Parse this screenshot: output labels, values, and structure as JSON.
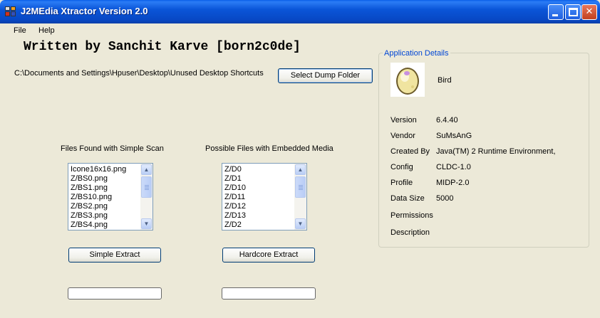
{
  "window": {
    "title": "J2MEdia Xtractor Version 2.0",
    "controls": {
      "minimize": "minimize",
      "maximize": "maximize",
      "close": "close"
    }
  },
  "menu": {
    "file": "File",
    "help": "Help"
  },
  "main": {
    "author": "Written by Sanchit Karve [born2c0de]",
    "path": "C:\\Documents and Settings\\Hpuser\\Desktop\\Unused Desktop Shortcuts",
    "select_dump_label": "Select Dump Folder"
  },
  "simple_scan": {
    "caption": "Files Found with Simple Scan",
    "items": [
      "Icone16x16.png",
      "Z/BS0.png",
      "Z/BS1.png",
      "Z/BS10.png",
      "Z/BS2.png",
      "Z/BS3.png",
      "Z/BS4.png"
    ],
    "extract_label": "Simple Extract",
    "progress": 0
  },
  "embedded": {
    "caption": "Possible Files with Embedded Media",
    "items": [
      "Z/D0",
      "Z/D1",
      "Z/D10",
      "Z/D11",
      "Z/D12",
      "Z/D13",
      "Z/D2"
    ],
    "extract_label": "Hardcore Extract",
    "progress": 0
  },
  "details": {
    "title": "Application Details",
    "app_name": "Bird",
    "icon": "egg-icon",
    "rows": [
      {
        "label": "Version",
        "value": "6.4.40"
      },
      {
        "label": "Vendor",
        "value": "SuMsAnG"
      },
      {
        "label": "Created By",
        "value": "Java(TM) 2 Runtime Environment,"
      },
      {
        "label": "Config",
        "value": "CLDC-1.0"
      },
      {
        "label": "Profile",
        "value": "MIDP-2.0"
      },
      {
        "label": "Data Size",
        "value": "5000"
      },
      {
        "label": "Permissions",
        "value": ""
      },
      {
        "label": "Description",
        "value": ""
      }
    ]
  },
  "colors": {
    "titlebar": "#0a55d8",
    "window_bg": "#ece9d8",
    "group_title": "#0046d5",
    "close_button": "#c2401f"
  }
}
